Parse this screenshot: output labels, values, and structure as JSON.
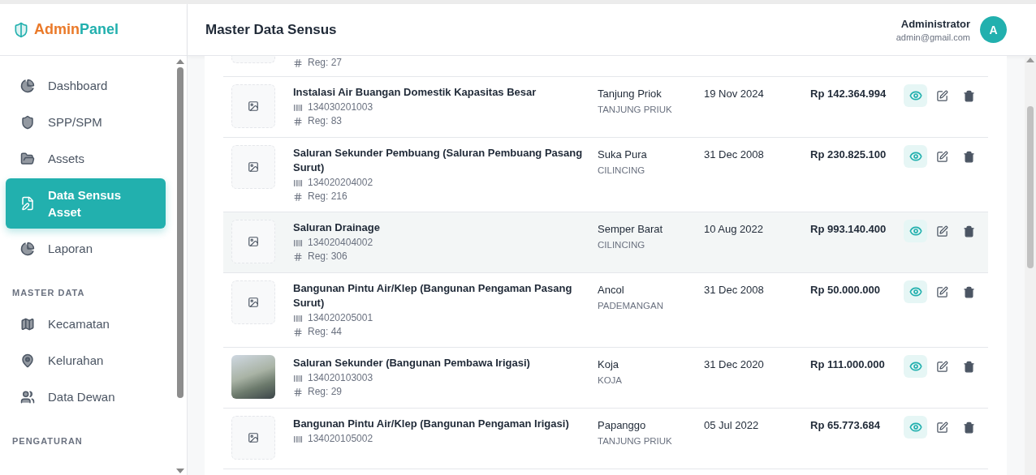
{
  "brand": {
    "first": "Admin",
    "second": "Panel"
  },
  "header": {
    "title": "Master Data Sensus",
    "user_name": "Administrator",
    "user_email": "admin@gmail.com",
    "avatar": "A"
  },
  "sidebar": {
    "sections": [
      {
        "items": [
          {
            "label": "Dashboard",
            "selected": false
          },
          {
            "label": "SPP/SPM",
            "selected": false
          },
          {
            "label": "Assets",
            "selected": false
          },
          {
            "label": "Data Sensus Asset",
            "selected": true
          },
          {
            "label": "Laporan",
            "selected": false
          }
        ]
      },
      {
        "heading": "MASTER DATA",
        "items": [
          {
            "label": "Kecamatan",
            "selected": false
          },
          {
            "label": "Kelurahan",
            "selected": false
          },
          {
            "label": "Data Dewan",
            "selected": false
          }
        ]
      },
      {
        "heading": "PENGATURAN"
      }
    ]
  },
  "table": {
    "rows": [
      {
        "kind": "clipped",
        "reg": "Reg: 27"
      },
      {
        "kind": "placeholder",
        "title": "Instalasi Air Buangan Domestik Kapasitas Besar",
        "code": "134030201003",
        "reg": "Reg: 83",
        "location": "Tanjung Priok",
        "district": "TANJUNG PRIUK",
        "date": "19 Nov 2024",
        "price": "Rp 142.364.994",
        "highlighted": false
      },
      {
        "kind": "placeholder",
        "title": "Saluran Sekunder Pembuang (Saluran Pembuang Pasang Surut)",
        "code": "134020204002",
        "reg": "Reg: 216",
        "location": "Suka Pura",
        "district": "CILINCING",
        "date": "31 Dec 2008",
        "price": "Rp 230.825.100",
        "highlighted": false
      },
      {
        "kind": "placeholder",
        "title": "Saluran Drainage",
        "code": "134020404002",
        "reg": "Reg: 306",
        "location": "Semper Barat",
        "district": "CILINCING",
        "date": "10 Aug 2022",
        "price": "Rp 993.140.400",
        "highlighted": true
      },
      {
        "kind": "placeholder",
        "title": "Bangunan Pintu Air/Klep (Bangunan Pengaman Pasang Surut)",
        "code": "134020205001",
        "reg": "Reg: 44",
        "location": "Ancol",
        "district": "PADEMANGAN",
        "date": "31 Dec 2008",
        "price": "Rp 50.000.000",
        "highlighted": false
      },
      {
        "kind": "photo",
        "title": "Saluran Sekunder (Bangunan Pembawa Irigasi)",
        "code": "134020103003",
        "reg": "Reg: 29",
        "location": "Koja",
        "district": "KOJA",
        "date": "31 Dec 2020",
        "price": "Rp 111.000.000",
        "highlighted": false
      },
      {
        "kind": "placeholder",
        "title": "Bangunan Pintu Air/Klep (Bangunan Pengaman Irigasi)",
        "code": "134020105002",
        "location": "Papanggo",
        "district": "TANJUNG PRIUK",
        "date": "05 Jul 2022",
        "price": "Rp 65.773.684",
        "highlighted": false
      }
    ]
  }
}
